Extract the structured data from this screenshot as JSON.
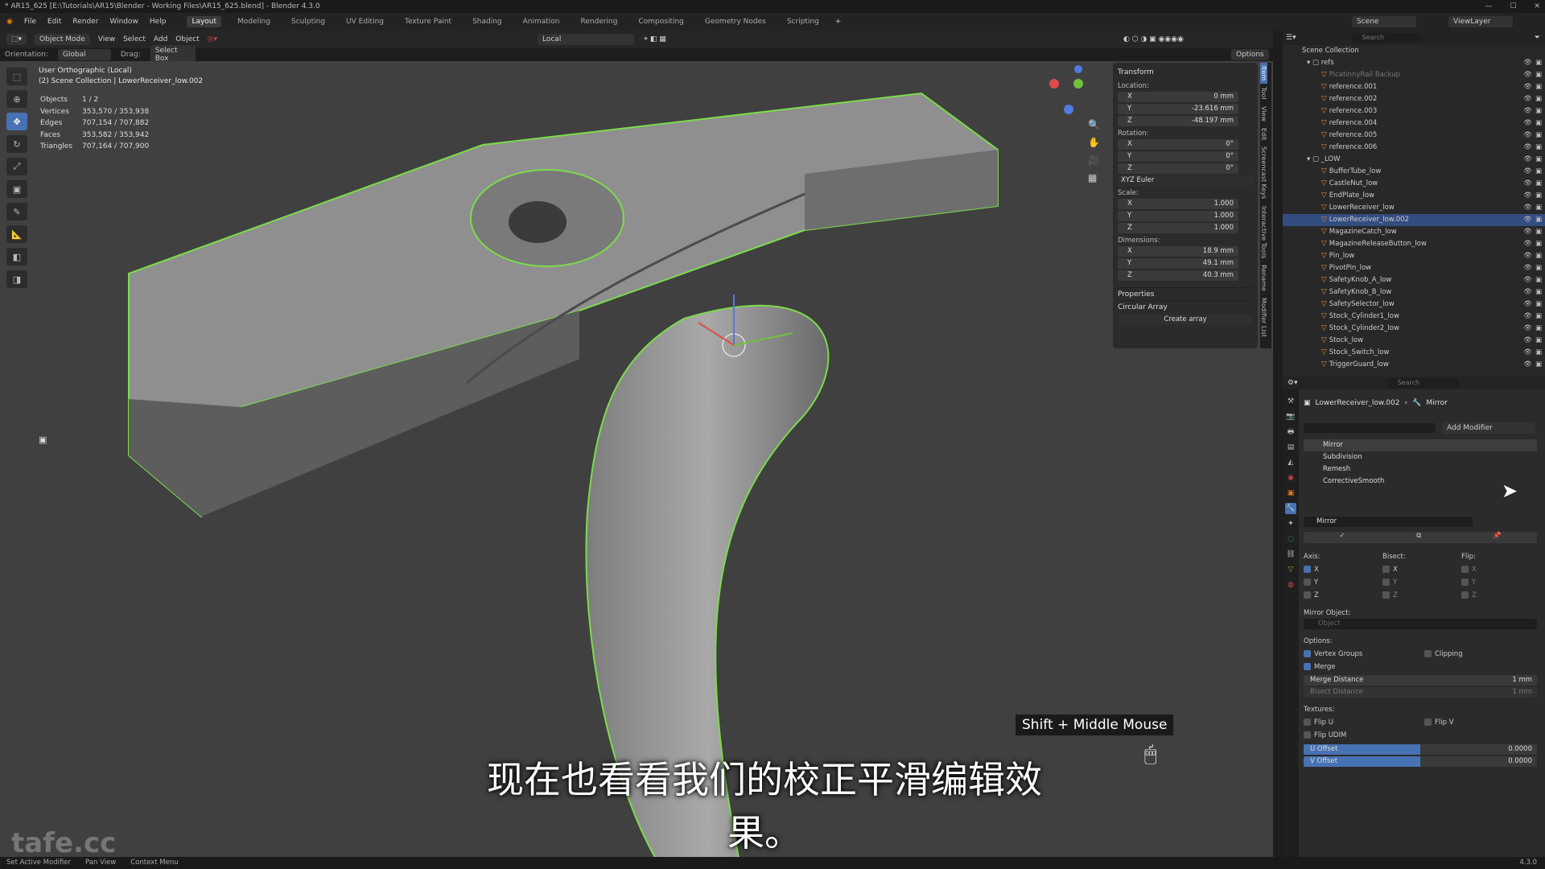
{
  "window": {
    "title": "* AR15_625 [E:\\Tutorials\\AR15\\Blender - Working Files\\AR15_625.blend] - Blender 4.3.0"
  },
  "menu": {
    "items": [
      "File",
      "Edit",
      "Render",
      "Window",
      "Help"
    ],
    "workspaces": [
      "Layout",
      "Modeling",
      "Sculpting",
      "UV Editing",
      "Texture Paint",
      "Shading",
      "Animation",
      "Rendering",
      "Compositing",
      "Geometry Nodes",
      "Scripting"
    ],
    "scene": "Scene",
    "view_layer": "ViewLayer"
  },
  "header": {
    "mode": "Object Mode",
    "view": "View",
    "select": "Select",
    "add": "Add",
    "object": "Object",
    "pivot": "Local",
    "orientation_label": "Orientation:",
    "orientation": "Global",
    "drag_label": "Drag:",
    "drag": "Select Box",
    "options": "Options"
  },
  "viewport": {
    "view_name": "User Orthographic (Local)",
    "collection": "(2) Scene Collection | LowerReceiver_low.002",
    "stats": [
      {
        "k": "Objects",
        "v": "1 / 2"
      },
      {
        "k": "Vertices",
        "v": "353,570 / 353,938"
      },
      {
        "k": "Edges",
        "v": "707,154 / 707,882"
      },
      {
        "k": "Faces",
        "v": "353,582 / 353,942"
      },
      {
        "k": "Triangles",
        "v": "707,164 / 707,900"
      }
    ]
  },
  "transform": {
    "title": "Transform",
    "location_label": "Location:",
    "location": {
      "x": "0 mm",
      "y": "-23.616 mm",
      "z": "-48.197 mm"
    },
    "rotation_label": "Rotation:",
    "rotation": {
      "x": "0°",
      "y": "0°",
      "z": "0°"
    },
    "rotation_mode": "XYZ Euler",
    "scale_label": "Scale:",
    "scale": {
      "x": "1.000",
      "y": "1.000",
      "z": "1.000"
    },
    "dimensions_label": "Dimensions:",
    "dimensions": {
      "x": "18.9 mm",
      "y": "49.1 mm",
      "z": "40.3 mm"
    },
    "properties": "Properties",
    "circular_array": "Circular Array",
    "create_array": "Create array"
  },
  "sidetabs": [
    "Item",
    "Tool",
    "View",
    "Edit",
    "Screencast Keys",
    "Interactive Tools",
    "Rename",
    "Modifier List"
  ],
  "outliner": {
    "search": "Search",
    "root": "Scene Collection",
    "groups": [
      {
        "name": "refs",
        "items": [
          "PicatinnyRail Backup",
          "reference.001",
          "reference.002",
          "reference.003",
          "reference.004",
          "reference.005",
          "reference.006"
        ]
      },
      {
        "name": "_LOW",
        "items": [
          "BufferTube_low",
          "CastleNut_low",
          "EndPlate_low",
          "LowerReceiver_low",
          "LowerReceiver_low.002",
          "MagazineCatch_low",
          "MagazineReleaseButton_low",
          "Pin_low",
          "PivotPin_low",
          "SafetyKnob_A_low",
          "SafetyKnob_B_low",
          "SafetySelector_low",
          "Stock_Cylinder1_low",
          "Stock_Cylinder2_low",
          "Stock_low",
          "Stock_Switch_low",
          "TriggerGuard_low"
        ]
      }
    ],
    "selected": "LowerReceiver_low.002"
  },
  "properties": {
    "search": "Search",
    "breadcrumb_object": "LowerReceiver_low.002",
    "breadcrumb_modifier": "Mirror",
    "add_modifier": "Add Modifier",
    "modifiers": [
      "Mirror",
      "Subdivision",
      "Remesh",
      "CorrectiveSmooth"
    ],
    "mirror": {
      "name": "Mirror",
      "axis_label": "Axis:",
      "bisect_label": "Bisect:",
      "flip_label": "Flip:",
      "x": "X",
      "y": "Y",
      "z": "Z",
      "mirror_object_label": "Mirror Object:",
      "mirror_object_placeholder": "Object",
      "options_label": "Options:",
      "vertex_groups": "Vertex Groups",
      "clipping": "Clipping",
      "merge": "Merge",
      "merge_distance_label": "Merge Distance",
      "merge_distance": "1 mm",
      "bisect_distance_label": "Bisect Distance",
      "bisect_distance": "1 mm",
      "textures_label": "Textures:",
      "flip_u": "Flip U",
      "flip_v": "Flip V",
      "flip_udim": "Flip UDIM",
      "u_offset_label": "U Offset",
      "u_offset": "0.0000",
      "v_offset_label": "V Offset",
      "v_offset": "0.0000"
    }
  },
  "statusbar": {
    "items": [
      "Set Active Modifier",
      "Pan View",
      "Context Menu"
    ],
    "version": "4.3.0"
  },
  "overlay": {
    "subtitle": "现在也看看我们的校正平滑编辑效果。",
    "key_hint": "Shift + Middle Mouse",
    "watermark": "tafe.cc"
  },
  "colors": {
    "accent": "#4772b3",
    "outline": "#7bdc4a",
    "selected_row": "#334d80"
  }
}
